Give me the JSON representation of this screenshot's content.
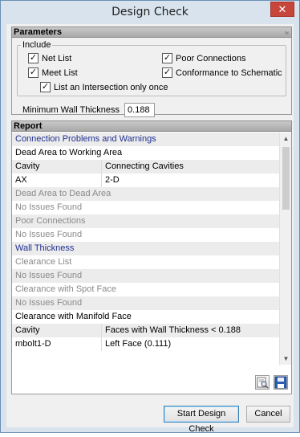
{
  "window": {
    "title": "Design Check",
    "close_glyph": "✕"
  },
  "parameters": {
    "header": "Parameters",
    "collapse_glyph": "≈",
    "include_label": "Include",
    "checkboxes": [
      {
        "label": "Net List",
        "checked": true
      },
      {
        "label": "Poor Connections",
        "checked": true
      },
      {
        "label": "Meet List",
        "checked": true
      },
      {
        "label": "Conformance to Schematic",
        "checked": true
      },
      {
        "label": "List an Intersection only once",
        "checked": true
      }
    ],
    "min_wall_label": "Minimum  Wall  Thickness",
    "min_wall_value": "0.188"
  },
  "report": {
    "header": "Report",
    "rows": {
      "r0": "Connection Problems and Warnings",
      "r1": "Dead Area to Working Area",
      "r2c1": "Cavity",
      "r2c2": "Connecting Cavities",
      "r3c1": "AX",
      "r3c2": "2-D",
      "r4": "Dead Area to Dead Area",
      "r5": "No Issues Found",
      "r6": "Poor Connections",
      "r7": "No Issues Found",
      "r8": "Wall Thickness",
      "r9": "Clearance List",
      "r10": "No Issues Found",
      "r11": "Clearance with Spot Face",
      "r12": "No Issues Found",
      "r13": "Clearance with Manifold Face",
      "r14c1": "Cavity",
      "r14c2": "Faces with Wall Thickness < 0.188",
      "r15c1": "mbolt1-D",
      "r15c2": "Left Face (0.111)"
    }
  },
  "buttons": {
    "start": "Start Design Check",
    "cancel": "Cancel"
  }
}
